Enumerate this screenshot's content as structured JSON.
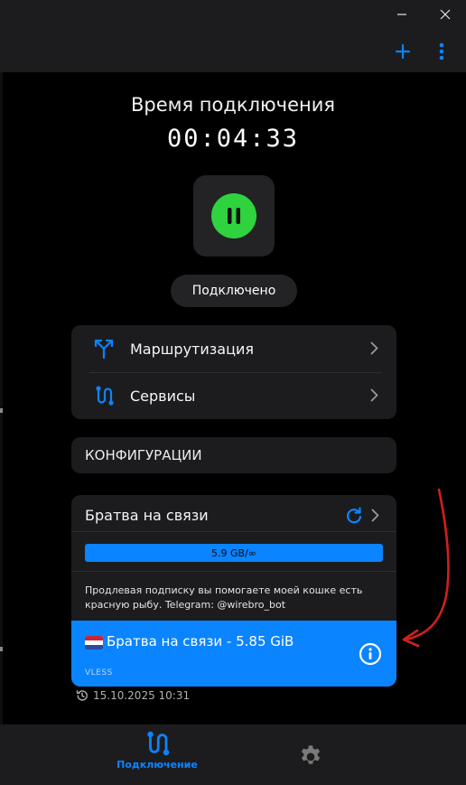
{
  "window": {
    "minimize_icon": "minimize-icon",
    "close_icon": "close-icon"
  },
  "toolbar": {
    "add_icon": "plus-icon",
    "menu_icon": "more-vertical-icon"
  },
  "connection": {
    "title": "Время подключения",
    "timer": "00:04:33",
    "toggle_icon": "pause-icon",
    "status": "Подключено"
  },
  "menu": {
    "items": [
      {
        "label": "Маршрутизация",
        "icon": "routing-icon"
      },
      {
        "label": "Сервисы",
        "icon": "services-icon"
      }
    ]
  },
  "configurations": {
    "title": "КОНФИГУРАЦИИ"
  },
  "subscription": {
    "name": "Братва на связи",
    "usage": "5.9 GB/∞",
    "note": "Продлевая подписку вы помогаете моей кошке есть красную рыбу. Telegram: @wirebro_bot",
    "refresh_icon": "refresh-icon",
    "server": {
      "name": "Братва на связи - 5.85 GiB",
      "protocol": "VLESS",
      "flag": "netherlands-flag-icon"
    },
    "updated": "15.10.2025 10:31"
  },
  "nav": {
    "connection_label": "Подключение",
    "settings_icon": "gear-icon"
  },
  "colors": {
    "accent": "#0b84ff",
    "connected": "#2ed33e",
    "card": "#1c1c1e",
    "background": "#000000"
  }
}
